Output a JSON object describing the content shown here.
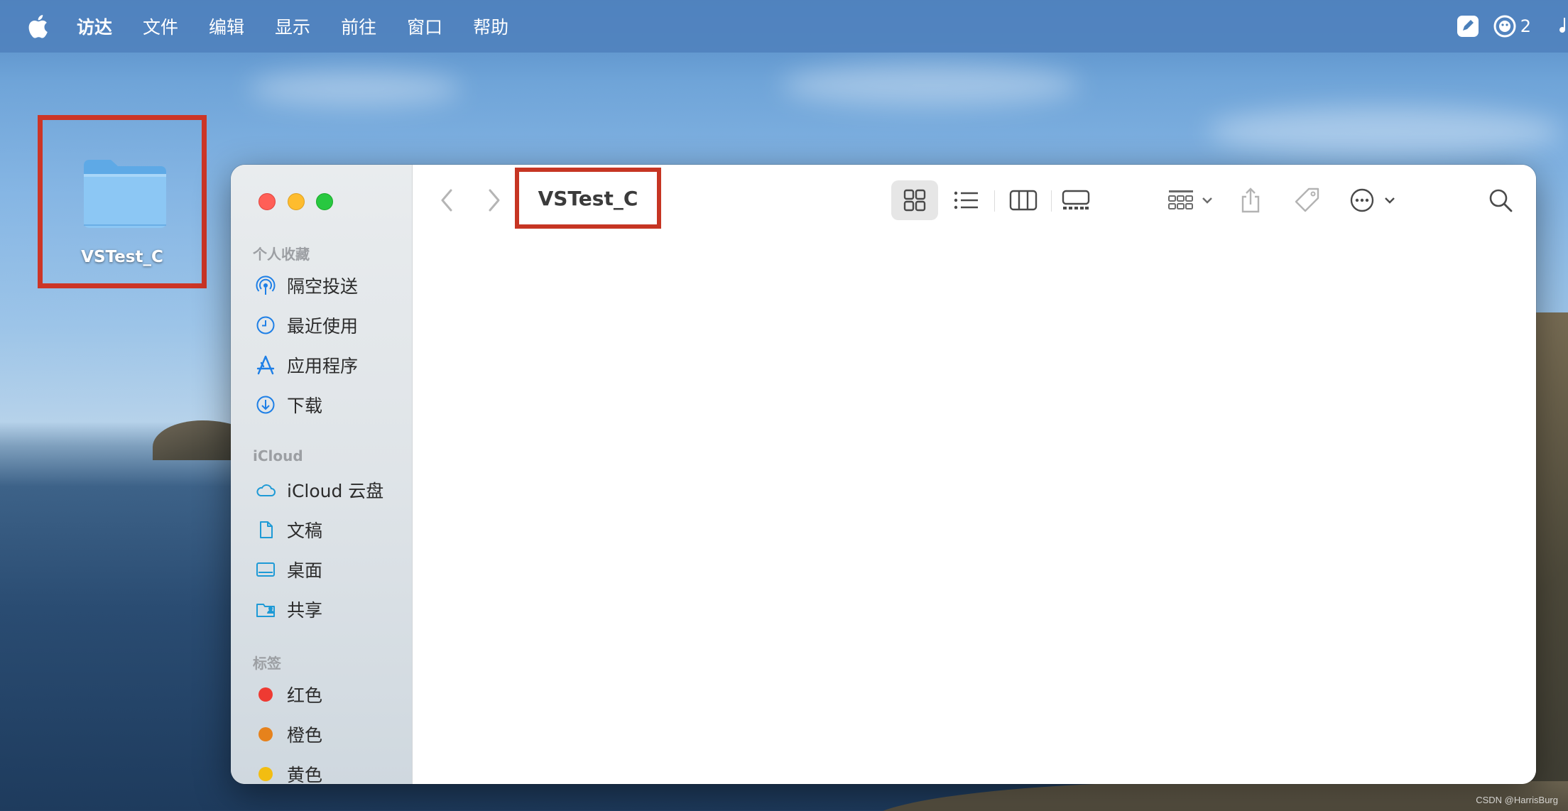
{
  "menubar": {
    "items": [
      "访达",
      "文件",
      "编辑",
      "显示",
      "前往",
      "窗口",
      "帮助"
    ],
    "notification_count": "2"
  },
  "desktop": {
    "folder_label": "VSTest_C",
    "watermark": "CSDN @HarrisBurg"
  },
  "finder": {
    "title": "VSTest_C",
    "sidebar": {
      "favorites_title": "个人收藏",
      "favorites": [
        {
          "label": "隔空投送",
          "icon": "airdrop-icon"
        },
        {
          "label": "最近使用",
          "icon": "clock-icon"
        },
        {
          "label": "应用程序",
          "icon": "applications-icon"
        },
        {
          "label": "下载",
          "icon": "download-icon"
        }
      ],
      "icloud_title": "iCloud",
      "icloud": [
        {
          "label": "iCloud 云盘",
          "icon": "cloud-icon"
        },
        {
          "label": "文稿",
          "icon": "document-icon"
        },
        {
          "label": "桌面",
          "icon": "desktop-icon"
        },
        {
          "label": "共享",
          "icon": "shared-folder-icon"
        }
      ],
      "tags_title": "标签",
      "tags": [
        {
          "label": "红色",
          "color": "#ee3a32"
        },
        {
          "label": "橙色",
          "color": "#e6821c"
        },
        {
          "label": "黄色",
          "color": "#f2bd11"
        }
      ]
    },
    "colors": {
      "sidebar_icon": "#1e7fe6",
      "highlight_box": "#c63523"
    }
  }
}
